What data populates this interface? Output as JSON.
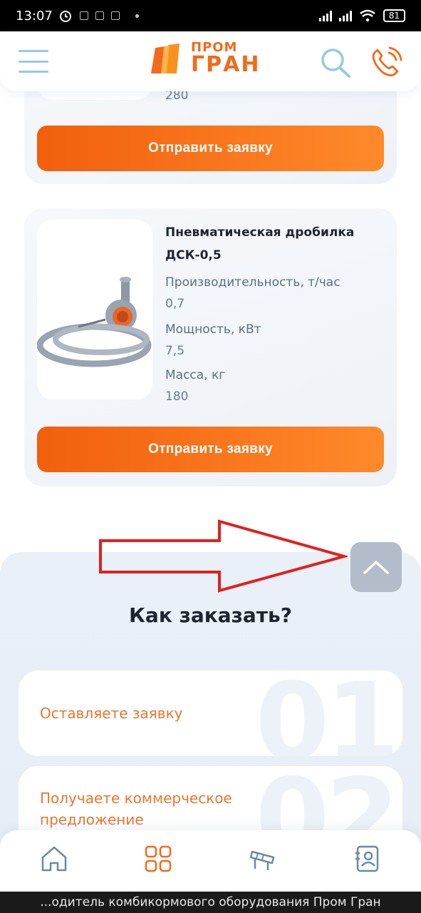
{
  "status_bar": {
    "time": "13:07",
    "battery": "81"
  },
  "header": {
    "logo_top": "ПРОМ",
    "logo_bottom": "ГРАН",
    "brand_color": "#f26a1b"
  },
  "cards": [
    {
      "partial_value": "280",
      "button_label": "Отправить заявку"
    },
    {
      "title": "Пневматическая дробилка ДСК-0,5",
      "specs": [
        {
          "label": "Производительность, т/час",
          "value": "0,7"
        },
        {
          "label": "Мощность, кВт",
          "value": "7,5"
        },
        {
          "label": "Масса, кг",
          "value": "180"
        }
      ],
      "button_label": "Отправить заявку"
    }
  ],
  "how_to_order": {
    "title": "Как заказать?",
    "steps": [
      {
        "number": "01",
        "text": "Оставляете заявку"
      },
      {
        "number": "02",
        "text": "Получаете коммерческое предложение"
      }
    ]
  },
  "bottom_nav": {
    "items": [
      "home-icon",
      "catalog-grid-icon",
      "equipment-icon",
      "contacts-icon"
    ]
  },
  "browser_caption": "...одитель комбикормового оборудования Пром Гран",
  "colors": {
    "accent_orange": "#f26a1b",
    "annotation_red": "#e0201e",
    "scroll_button": "#b3bcca"
  }
}
